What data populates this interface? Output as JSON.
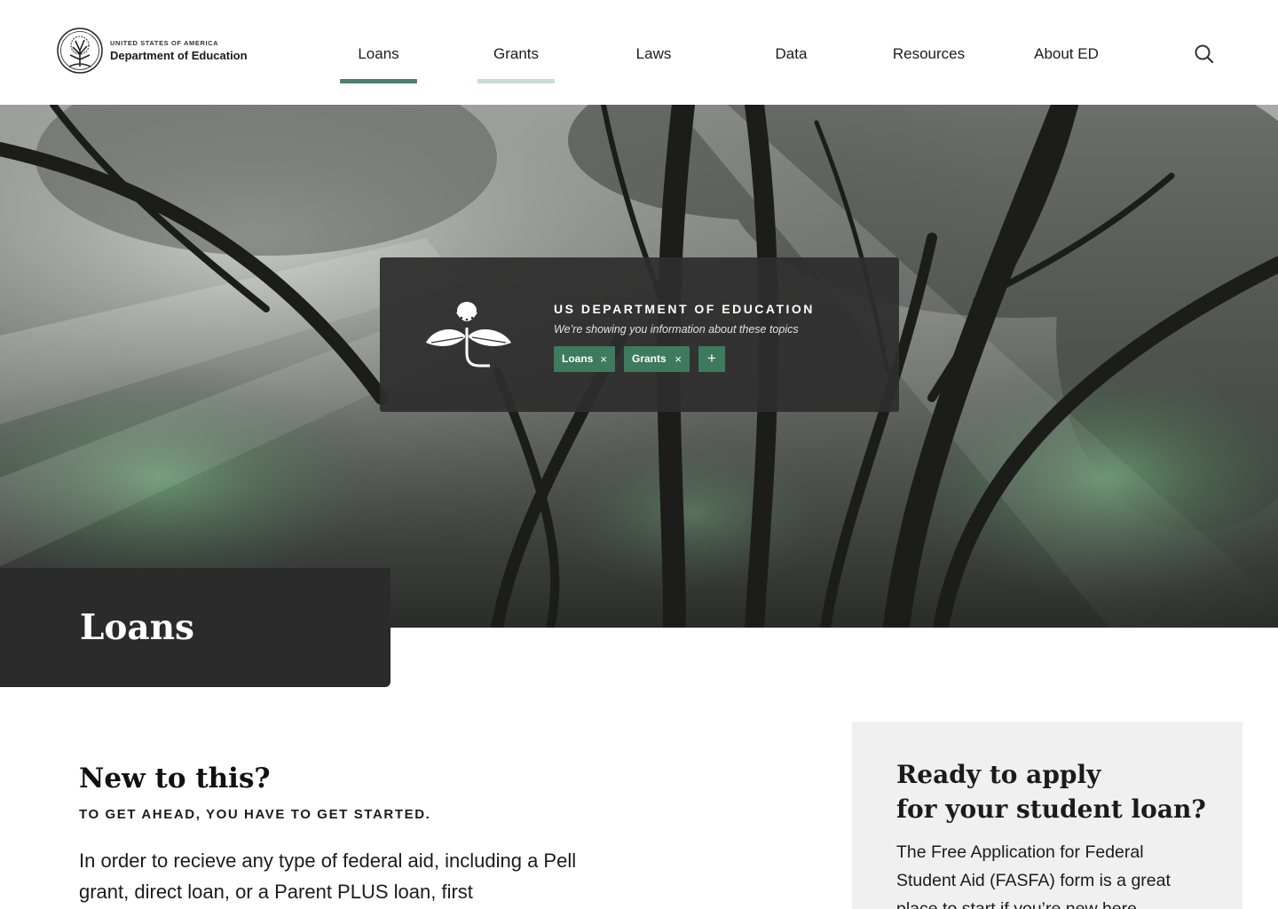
{
  "header": {
    "agency_small": "UNITED STATES OF AMERICA",
    "agency_name": "Department of Education",
    "nav": [
      {
        "label": "Loans",
        "state": "active"
      },
      {
        "label": "Grants",
        "state": "selected"
      },
      {
        "label": "Laws",
        "state": ""
      },
      {
        "label": "Data",
        "state": ""
      },
      {
        "label": "Resources",
        "state": ""
      },
      {
        "label": "About ED",
        "state": ""
      }
    ],
    "search_icon": "search-icon"
  },
  "hero": {
    "card": {
      "title": "US DEPARTMENT OF EDUCATION",
      "subtitle": "We’re showing you information about these topics",
      "topics": [
        {
          "label": "Loans",
          "remove": "×"
        },
        {
          "label": "Grants",
          "remove": "×"
        }
      ],
      "add_label": "+"
    }
  },
  "page": {
    "title": "Loans"
  },
  "intro": {
    "heading": "New to this?",
    "kicker": "TO GET AHEAD, YOU HAVE TO GET STARTED.",
    "body": "In order to recieve any type of federal aid, including a Pell grant, direct loan, or a Parent PLUS loan, first"
  },
  "cta": {
    "heading_line1": "Ready to apply",
    "heading_line2": "for your student loan?",
    "body": "The Free Application for Federal Student Aid (FASFA) form is a great place to start if you’re new here."
  },
  "colors": {
    "accent_green": "#4d8068",
    "chip_green": "#3d7a5e",
    "soft_green": "#c9ddd3",
    "dark_panel": "#2b2b2b",
    "cta_background": "#f0f0f0"
  }
}
